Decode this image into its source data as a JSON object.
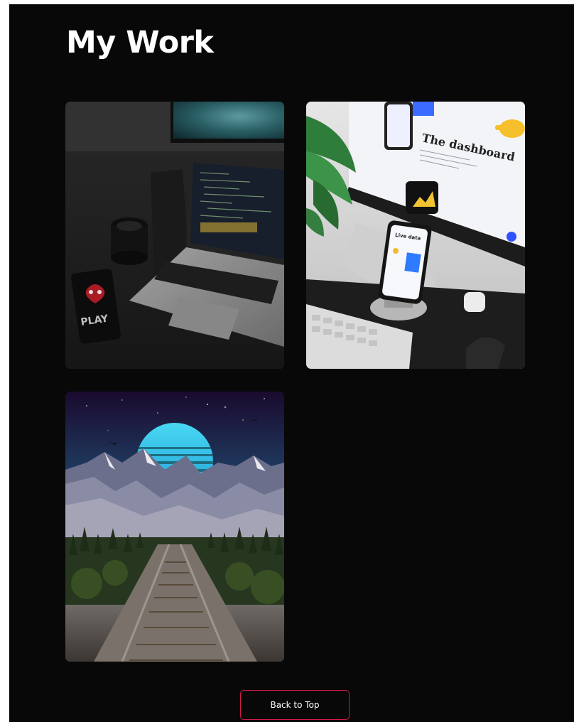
{
  "section": {
    "title": "My Work"
  },
  "projects": [
    {
      "name": "laptop-workspace-photo",
      "icon": "laptop-desk-image",
      "phone_case_text": "PLAY"
    },
    {
      "name": "dashboard-device-photo",
      "icon": "monitor-phone-image",
      "screen_heading": "The dashboard",
      "phone_heading": "Live data"
    },
    {
      "name": "retro-mountain-railway-art",
      "icon": "synthwave-landscape-image"
    }
  ],
  "footer": {
    "back_to_top_label": "Back to Top"
  },
  "colors": {
    "background": "#080808",
    "text": "#ffffff",
    "accent_border": "#d11a4a"
  }
}
